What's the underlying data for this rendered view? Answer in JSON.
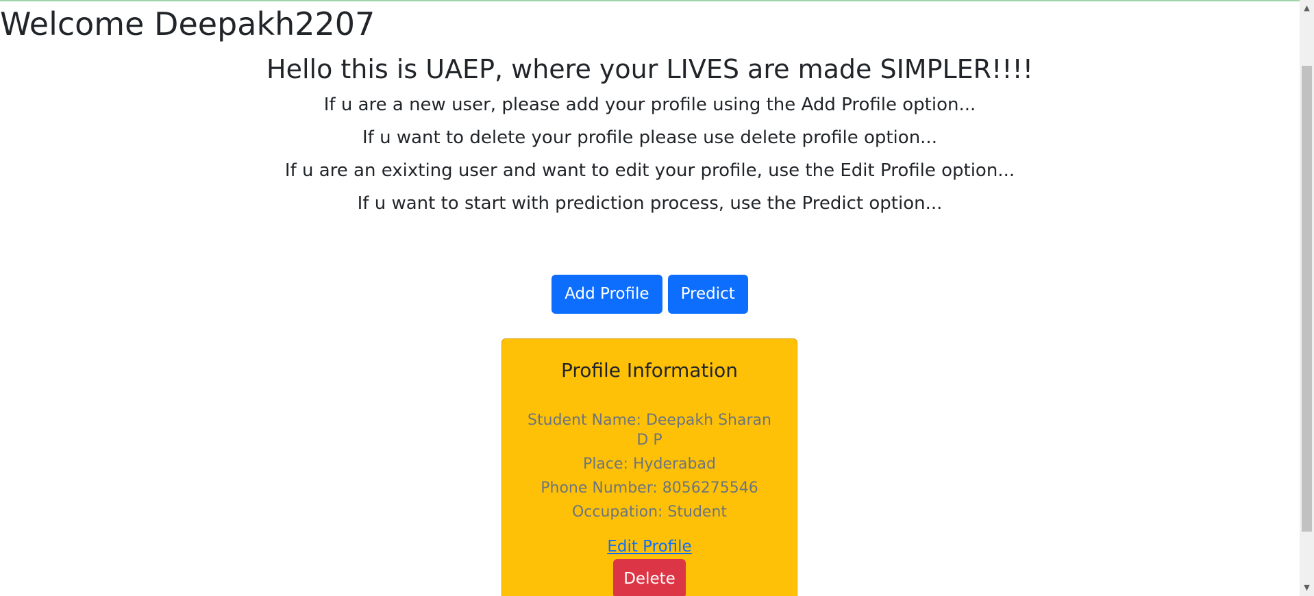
{
  "header": {
    "welcome": "Welcome Deepakh2207"
  },
  "hero": {
    "title": "Hello this is UAEP, where your LIVES are made SIMPLER!!!!",
    "lines": [
      "If u are a new user, please add your profile using the Add Profile option...",
      "If u want to delete your profile please use delete profile option...",
      "If u are an exixting user and want to edit your profile, use the Edit Profile option...",
      "If u want to start with prediction process, use the Predict option..."
    ]
  },
  "actions": {
    "add_profile": "Add Profile",
    "predict": "Predict"
  },
  "profile": {
    "title": "Profile Information",
    "student_name": "Student Name: Deepakh Sharan D P",
    "place": "Place: Hyderabad",
    "phone": "Phone Number: 8056275546",
    "occupation": "Occupation: Student",
    "edit_link": "Edit Profile",
    "delete_button": "Delete"
  },
  "colors": {
    "primary": "#0d6efd",
    "card": "#ffc107",
    "danger": "#dc3545",
    "muted_text": "#6c757d"
  },
  "scrollbar": {
    "up_icon": "scroll-up-arrow",
    "down_icon": "scroll-down-arrow"
  }
}
